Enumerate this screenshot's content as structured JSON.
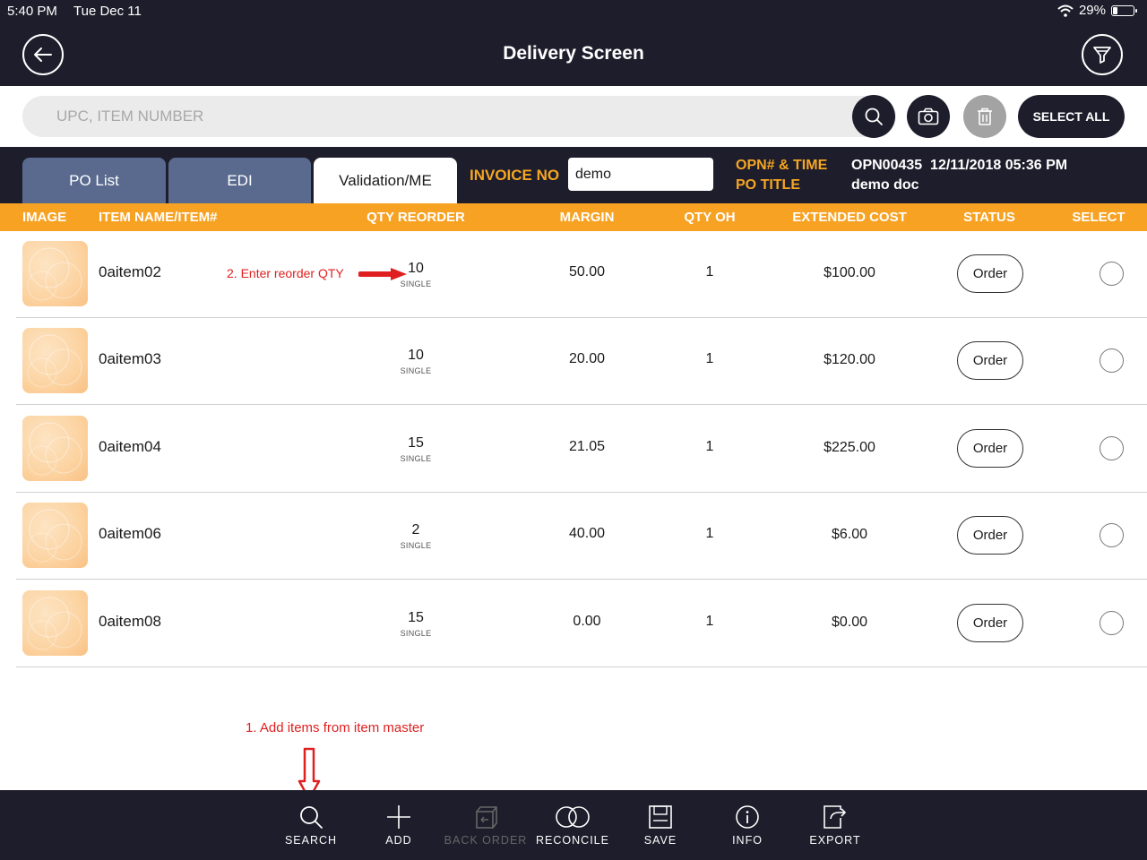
{
  "status_bar": {
    "time": "5:40 PM",
    "date": "Tue Dec 11",
    "battery": "29%",
    "battery_level": 0.29
  },
  "header": {
    "title": "Delivery Screen"
  },
  "search": {
    "placeholder": "UPC, ITEM NUMBER",
    "select_all": "SELECT ALL"
  },
  "tabs": [
    {
      "label": "PO List",
      "active": false
    },
    {
      "label": "EDI",
      "active": false
    },
    {
      "label": "Validation/ME",
      "active": true
    }
  ],
  "invoice": {
    "label": "INVOICE NO",
    "value": "demo"
  },
  "opn": {
    "label1": "OPN# & TIME",
    "label2": "PO TITLE",
    "number_time": "OPN00435  12/11/2018 05:36 PM",
    "title": "demo doc"
  },
  "columns": {
    "image": "IMAGE",
    "item": "ITEM NAME/ITEM#",
    "qty_reorder": "QTY REORDER",
    "margin": "MARGIN",
    "qty_oh": "QTY OH",
    "extended_cost": "EXTENDED COST",
    "status": "STATUS",
    "select": "SELECT"
  },
  "rows": [
    {
      "name": "0aitem02",
      "qty": "10",
      "unit": "SINGLE",
      "margin": "50.00",
      "qty_oh": "1",
      "cost": "$100.00",
      "status": "Order"
    },
    {
      "name": "0aitem03",
      "qty": "10",
      "unit": "SINGLE",
      "margin": "20.00",
      "qty_oh": "1",
      "cost": "$120.00",
      "status": "Order"
    },
    {
      "name": "0aitem04",
      "qty": "15",
      "unit": "SINGLE",
      "margin": "21.05",
      "qty_oh": "1",
      "cost": "$225.00",
      "status": "Order"
    },
    {
      "name": "0aitem06",
      "qty": "2",
      "unit": "SINGLE",
      "margin": "40.00",
      "qty_oh": "1",
      "cost": "$6.00",
      "status": "Order"
    },
    {
      "name": "0aitem08",
      "qty": "15",
      "unit": "SINGLE",
      "margin": "0.00",
      "qty_oh": "1",
      "cost": "$0.00",
      "status": "Order"
    }
  ],
  "annotations": {
    "qty": "2. Enter reorder QTY",
    "add": "1. Add items from item master",
    "color": "#e02020"
  },
  "toolbar": {
    "search": "SEARCH",
    "add": "ADD",
    "back_order": "BACK ORDER",
    "reconcile": "RECONCILE",
    "save": "SAVE",
    "info": "INFO",
    "export": "EXPORT"
  },
  "colors": {
    "navy": "#1e1d2b",
    "orange": "#f7a223",
    "tab_inactive": "#5a6a8f",
    "label_orange": "#f5a623"
  }
}
